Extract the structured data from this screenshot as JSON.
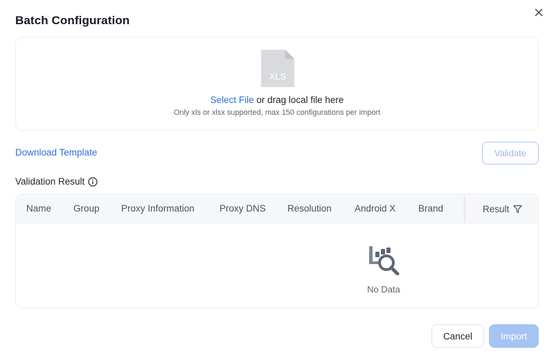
{
  "dialog": {
    "title": "Batch Configuration",
    "close_icon": "close-icon"
  },
  "upload": {
    "file_icon": "xls-file-icon",
    "file_icon_text": "XLS",
    "select_link": "Select File",
    "drag_text": " or drag local file here",
    "hint": "Only xls or xlsx supported, max 150 configurations per import"
  },
  "actions": {
    "download_template": "Download Template",
    "validate": "Validate"
  },
  "validation": {
    "label": "Validation Result",
    "info_icon": "info-icon"
  },
  "table": {
    "columns": [
      "Name",
      "Group",
      "Proxy Information",
      "Proxy DNS",
      "Resolution",
      "Android X",
      "Brand"
    ],
    "result_column": "Result",
    "filter_icon": "filter-icon",
    "empty_icon": "no-data-search-icon",
    "empty_text": "No Data"
  },
  "footer": {
    "cancel": "Cancel",
    "import": "Import"
  },
  "colors": {
    "link": "#2f6ed7",
    "primary_disabled": "#a5c3f3"
  }
}
